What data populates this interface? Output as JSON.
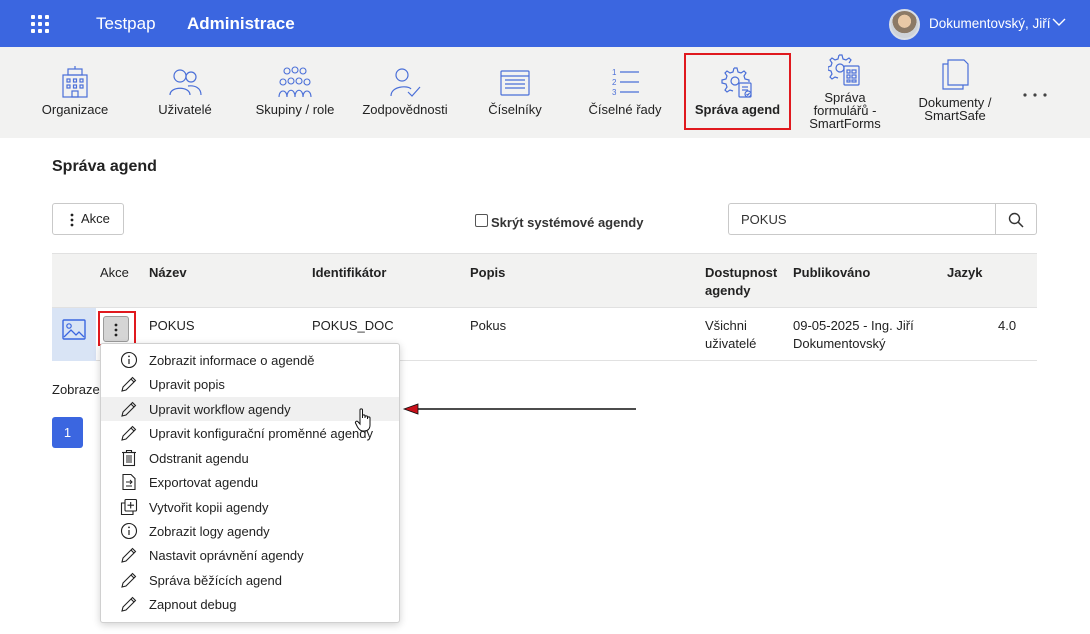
{
  "header": {
    "app_name": "Testpap",
    "section": "Administrace",
    "user_name": "Dokumentovský, Jiří"
  },
  "toolbar": {
    "items": [
      {
        "label": "Organizace",
        "icon": "building-icon"
      },
      {
        "label": "Uživatelé",
        "icon": "users-icon"
      },
      {
        "label": "Skupiny / role",
        "icon": "groups-icon"
      },
      {
        "label": "Zodpovědnosti",
        "icon": "user-check-icon"
      },
      {
        "label": "Číselníky",
        "icon": "codebook-icon"
      },
      {
        "label": "Číselné řady",
        "icon": "numbered-list-icon"
      },
      {
        "label": "Správa agend",
        "icon": "gear-document-icon"
      },
      {
        "label": "Správa formulářů - SmartForms",
        "line1": "Správa",
        "line2": "formulářů -",
        "line3": "SmartForms",
        "icon": "gear-form-icon"
      },
      {
        "label": "Dokumenty / SmartSafe",
        "line1": "Dokumenty /",
        "line2": "SmartSafe",
        "icon": "documents-icon"
      }
    ],
    "active_index": 6,
    "active_color": "#e0191e"
  },
  "page": {
    "title": "Správa agend",
    "actions_button": "Akce",
    "hide_system_label": "Skrýt systémové agendy",
    "hide_system_checked": false,
    "search_value": "POKUS",
    "shown_text": "Zobrazeno",
    "current_page": "1"
  },
  "table": {
    "headers": {
      "akce": "Akce",
      "nazev": "Název",
      "identifikator": "Identifikátor",
      "popis": "Popis",
      "dostupnost_1": "Dostupnost",
      "dostupnost_2": "agendy",
      "publikovano": "Publikováno",
      "jazyk": "Jazyk"
    },
    "rows": [
      {
        "nazev": "POKUS",
        "identifikator": "POKUS_DOC",
        "popis": "Pokus",
        "dostupnost_1": "Všichni",
        "dostupnost_2": "uživatelé",
        "publikovano_1": "09-05-2025 - Ing. Jiří",
        "publikovano_2": "Dokumentovský",
        "jazyk": "4.0"
      }
    ]
  },
  "menu": {
    "items": [
      {
        "label": "Zobrazit informace o agendě",
        "icon": "info-icon"
      },
      {
        "label": "Upravit popis",
        "icon": "pencil-icon"
      },
      {
        "label": "Upravit workflow agendy",
        "icon": "pencil-icon"
      },
      {
        "label": "Upravit konfigurační proměnné agendy",
        "icon": "pencil-icon"
      },
      {
        "label": "Odstranit agendu",
        "icon": "trash-icon"
      },
      {
        "label": "Exportovat agendu",
        "icon": "export-icon"
      },
      {
        "label": "Vytvořit kopii agendy",
        "icon": "copy-icon"
      },
      {
        "label": "Zobrazit logy agendy",
        "icon": "info-icon"
      },
      {
        "label": "Nastavit oprávnění agendy",
        "icon": "pencil-icon"
      },
      {
        "label": "Správa běžících agend",
        "icon": "pencil-icon"
      },
      {
        "label": "Zapnout debug",
        "icon": "pencil-icon"
      }
    ],
    "hovered_index": 2
  },
  "colors": {
    "header_bg": "#3b66e0",
    "toolbar_bg": "#f2f2f1",
    "highlight": "#e0191e"
  }
}
